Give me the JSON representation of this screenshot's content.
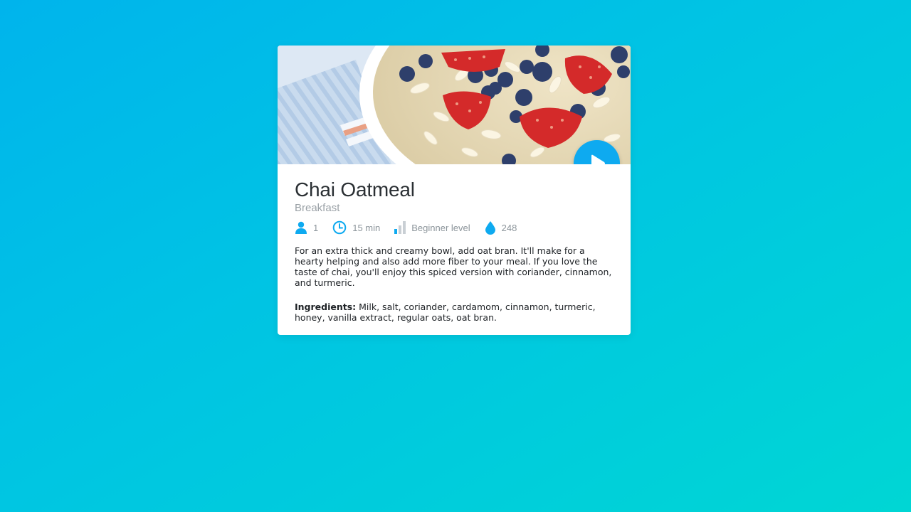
{
  "recipe": {
    "title": "Chai Oatmeal",
    "category": "Breakfast",
    "meta": {
      "servings": "1",
      "time": "15 min",
      "level": "Beginner level",
      "calories": "248"
    },
    "description": "For an extra thick and creamy bowl, add oat bran. It'll make for a hearty helping and also add more fiber to your meal. If you love the taste of chai, you'll enjoy this spiced version with coriander, cinnamon, and turmeric.",
    "ingredients_label": "Ingredients:",
    "ingredients_text": " Milk, salt, coriander, cardamom, cinnamon, turmeric, honey, vanilla extract, regular oats, oat bran."
  },
  "icons": {
    "servings": "person-icon",
    "time": "clock-icon",
    "level": "signal-bars-icon",
    "calories": "drop-icon",
    "play": "play-icon"
  },
  "colors": {
    "accent": "#0eaaf0",
    "background_start": "#00b4ec",
    "background_end": "#00d6d4",
    "title": "#2a2f33",
    "muted": "#9aa1a6"
  }
}
